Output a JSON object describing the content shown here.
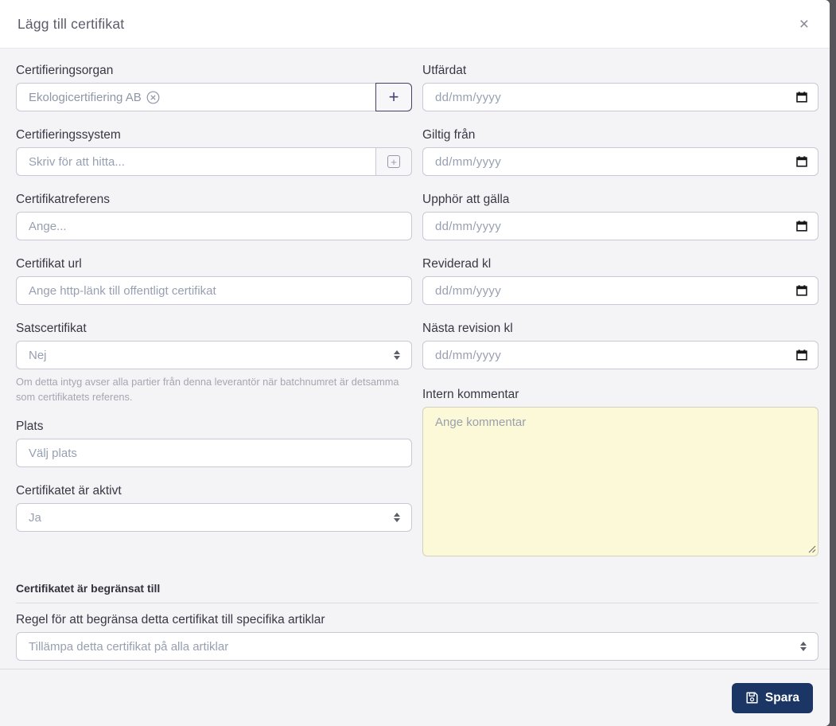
{
  "modal": {
    "title": "Lägg till certifikat",
    "close_label": "×"
  },
  "fields": {
    "certifieringsorgan": {
      "label": "Certifieringsorgan",
      "selected_value": "Ekologicertifiering AB",
      "add_label": "+"
    },
    "certifieringssystem": {
      "label": "Certifieringssystem",
      "placeholder": "Skriv för att hitta..."
    },
    "certifikatreferens": {
      "label": "Certifikatreferens",
      "placeholder": "Ange..."
    },
    "certifikat_url": {
      "label": "Certifikat url",
      "placeholder": "Ange http-länk till offentligt certifikat"
    },
    "satscertifikat": {
      "label": "Satscertifikat",
      "value": "Nej",
      "help": "Om detta intyg avser alla partier från denna leverantör när batchnumret är detsamma som certifikatets referens."
    },
    "plats": {
      "label": "Plats",
      "placeholder": "Välj plats"
    },
    "aktivt": {
      "label": "Certifikatet är aktivt",
      "value": "Ja"
    },
    "utfardat": {
      "label": "Utfärdat",
      "placeholder": "dd/mm/yyyy"
    },
    "giltig_fran": {
      "label": "Giltig från",
      "placeholder": "dd/mm/yyyy"
    },
    "upphor_att_galla": {
      "label": "Upphör att gälla",
      "placeholder": "dd/mm/yyyy"
    },
    "reviderad_kl": {
      "label": "Reviderad kl",
      "placeholder": "dd/mm/yyyy"
    },
    "nasta_revision_kl": {
      "label": "Nästa revision kl",
      "placeholder": "dd/mm/yyyy"
    },
    "intern_kommentar": {
      "label": "Intern kommentar",
      "placeholder": "Ange kommentar"
    }
  },
  "restriction": {
    "heading": "Certifikatet är begränsat till",
    "rule_label": "Regel för att begränsa detta certifikat till specifika artiklar",
    "rule_value": "Tillämpa detta certifikat på alla artiklar"
  },
  "footer": {
    "save_label": "Spara"
  },
  "colors": {
    "accent_navy": "#1b3564",
    "comment_bg": "#fcf9d8",
    "input_border": "#cbc7d6",
    "body_bg": "#f4f4f6"
  }
}
